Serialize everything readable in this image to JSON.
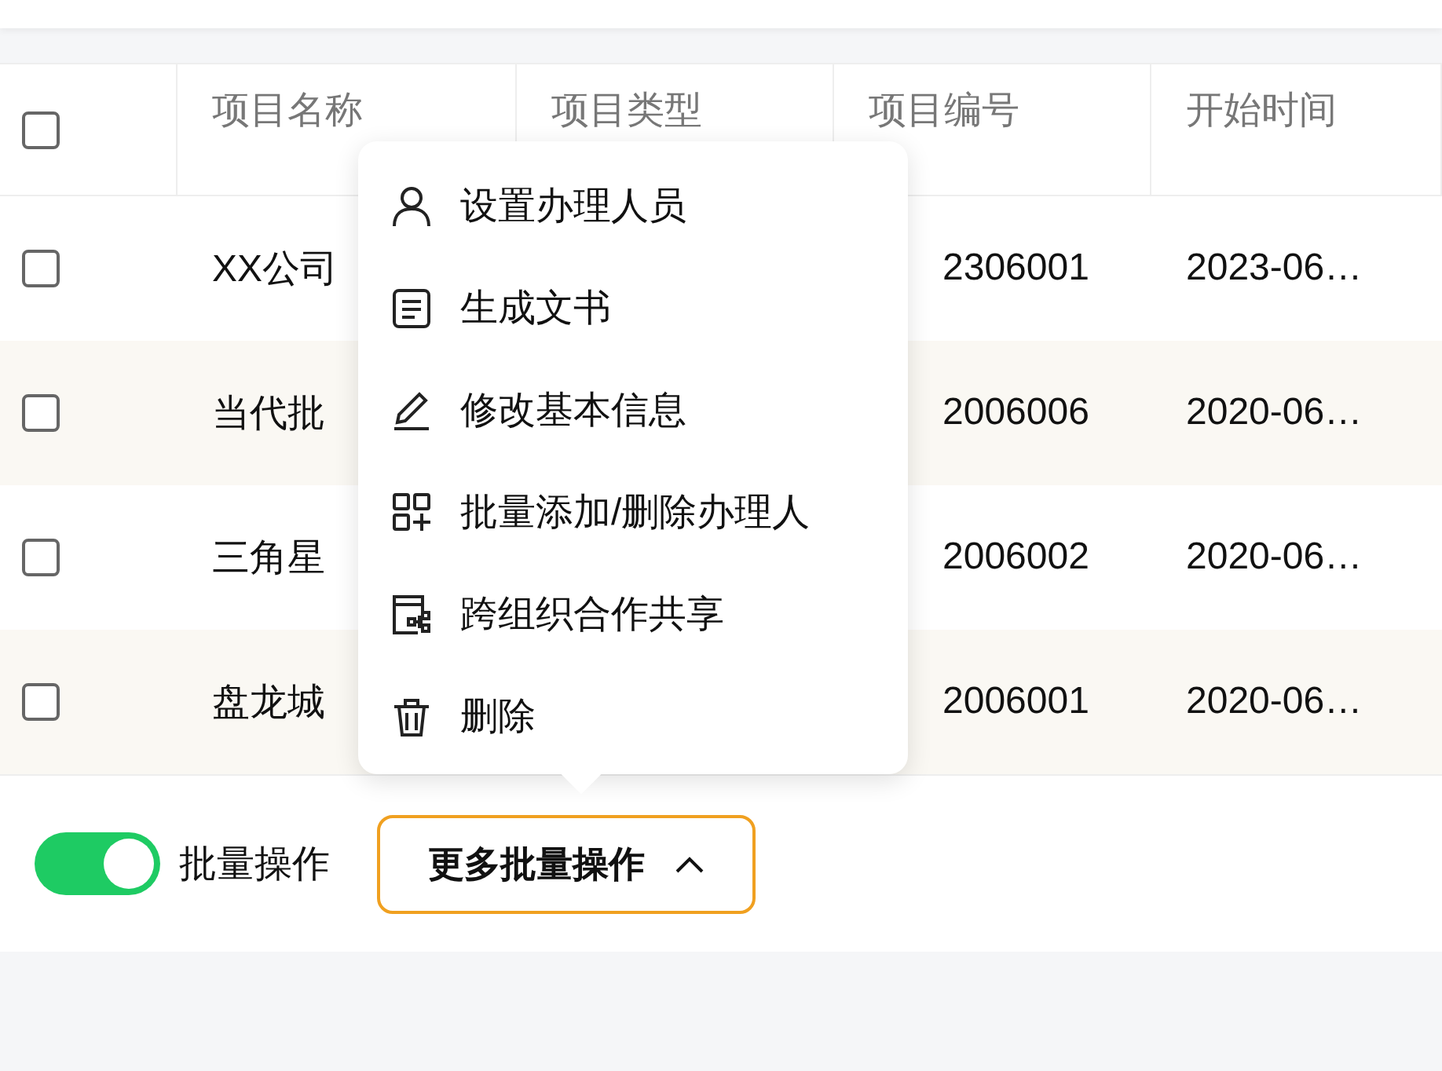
{
  "table": {
    "header_checkbox": {
      "checked": false
    },
    "columns": [
      "项目名称",
      "项目类型",
      "项目编号",
      "开始时间"
    ],
    "rows": [
      {
        "selected": false,
        "name": "XX公司",
        "number": "2306001",
        "start": "2023-06…"
      },
      {
        "selected": false,
        "name": "当代批",
        "number": "2006006",
        "start": "2020-06…"
      },
      {
        "selected": false,
        "name": "三角星",
        "number": "2006002",
        "start": "2020-06…"
      },
      {
        "selected": false,
        "name": "盘龙城",
        "number": "2006001",
        "start": "2020-06…"
      }
    ]
  },
  "menu": {
    "items": [
      {
        "kind": "person",
        "label": "设置办理人员"
      },
      {
        "kind": "document",
        "label": "生成文书"
      },
      {
        "kind": "pencil",
        "label": "修改基本信息"
      },
      {
        "kind": "grid-plus",
        "label": "批量添加/删除办理人"
      },
      {
        "kind": "share",
        "label": "跨组织合作共享"
      },
      {
        "kind": "trash",
        "label": "删除"
      }
    ]
  },
  "footer": {
    "batch_toggle": {
      "on": true,
      "label": "批量操作"
    },
    "more_button": {
      "label": "更多批量操作",
      "expanded": true
    }
  }
}
